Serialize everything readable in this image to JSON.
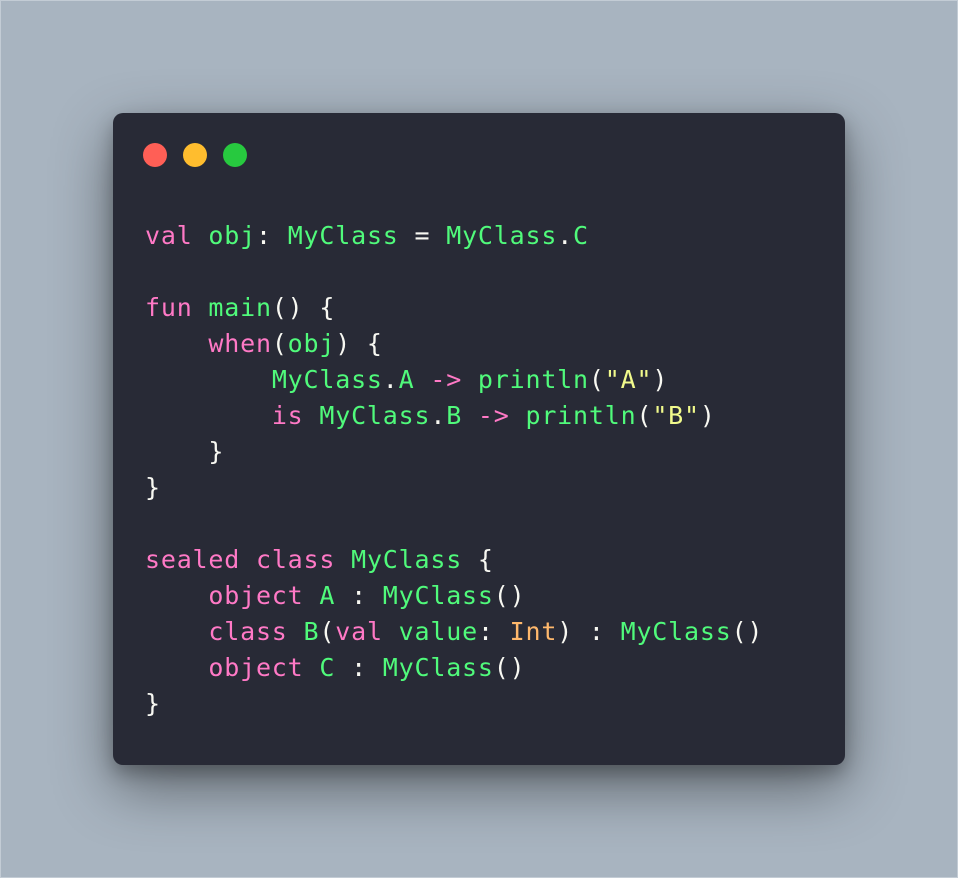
{
  "window_controls": [
    {
      "name": "close",
      "color": "#ff5f56"
    },
    {
      "name": "minimize",
      "color": "#ffbd2e"
    },
    {
      "name": "maximize",
      "color": "#27c93f"
    }
  ],
  "code_lines": [
    [
      [
        "kw",
        "val"
      ],
      [
        "p",
        " "
      ],
      [
        "id",
        "obj"
      ],
      [
        "p",
        ": "
      ],
      [
        "id",
        "MyClass"
      ],
      [
        "p",
        " = "
      ],
      [
        "id",
        "MyClass"
      ],
      [
        "p",
        "."
      ],
      [
        "id",
        "C"
      ]
    ],
    [],
    [
      [
        "kw",
        "fun"
      ],
      [
        "p",
        " "
      ],
      [
        "id",
        "main"
      ],
      [
        "p",
        "() {"
      ]
    ],
    [
      [
        "p",
        "    "
      ],
      [
        "kw",
        "when"
      ],
      [
        "p",
        "("
      ],
      [
        "id",
        "obj"
      ],
      [
        "p",
        ") {"
      ]
    ],
    [
      [
        "p",
        "        "
      ],
      [
        "id",
        "MyClass"
      ],
      [
        "p",
        "."
      ],
      [
        "id",
        "A"
      ],
      [
        "p",
        " "
      ],
      [
        "kw",
        "->"
      ],
      [
        "p",
        " "
      ],
      [
        "id",
        "println"
      ],
      [
        "p",
        "("
      ],
      [
        "str",
        "\"A\""
      ],
      [
        "p",
        ")"
      ]
    ],
    [
      [
        "p",
        "        "
      ],
      [
        "kw",
        "is"
      ],
      [
        "p",
        " "
      ],
      [
        "id",
        "MyClass"
      ],
      [
        "p",
        "."
      ],
      [
        "id",
        "B"
      ],
      [
        "p",
        " "
      ],
      [
        "kw",
        "->"
      ],
      [
        "p",
        " "
      ],
      [
        "id",
        "println"
      ],
      [
        "p",
        "("
      ],
      [
        "str",
        "\"B\""
      ],
      [
        "p",
        ")"
      ]
    ],
    [
      [
        "p",
        "    }"
      ]
    ],
    [
      [
        "p",
        "}"
      ]
    ],
    [],
    [
      [
        "kw",
        "sealed"
      ],
      [
        "p",
        " "
      ],
      [
        "kw",
        "class"
      ],
      [
        "p",
        " "
      ],
      [
        "id",
        "MyClass"
      ],
      [
        "p",
        " {"
      ]
    ],
    [
      [
        "p",
        "    "
      ],
      [
        "kw",
        "object"
      ],
      [
        "p",
        " "
      ],
      [
        "id",
        "A"
      ],
      [
        "p",
        " : "
      ],
      [
        "id",
        "MyClass"
      ],
      [
        "p",
        "()"
      ]
    ],
    [
      [
        "p",
        "    "
      ],
      [
        "kw",
        "class"
      ],
      [
        "p",
        " "
      ],
      [
        "id",
        "B"
      ],
      [
        "p",
        "("
      ],
      [
        "kw",
        "val"
      ],
      [
        "p",
        " "
      ],
      [
        "id",
        "value"
      ],
      [
        "p",
        ": "
      ],
      [
        "type",
        "Int"
      ],
      [
        "p",
        ") : "
      ],
      [
        "id",
        "MyClass"
      ],
      [
        "p",
        "()"
      ]
    ],
    [
      [
        "p",
        "    "
      ],
      [
        "kw",
        "object"
      ],
      [
        "p",
        " "
      ],
      [
        "id",
        "C"
      ],
      [
        "p",
        " : "
      ],
      [
        "id",
        "MyClass"
      ],
      [
        "p",
        "()"
      ]
    ],
    [
      [
        "p",
        "}"
      ]
    ]
  ]
}
